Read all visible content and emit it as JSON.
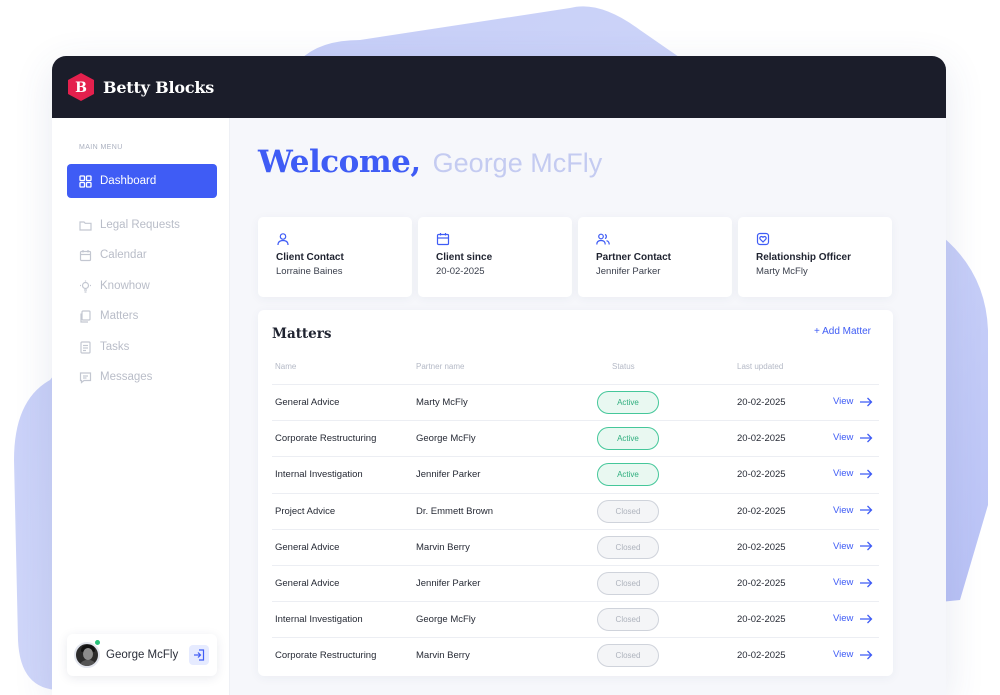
{
  "brand": {
    "name": "Betty Blocks",
    "logo_letter": "B",
    "accent": "#3f5cf5",
    "logo_color": "#e4204d"
  },
  "sidebar": {
    "caption": "MAIN MENU",
    "items": [
      {
        "label": "Dashboard",
        "icon": "grid-icon",
        "active": true
      },
      {
        "label": "Legal Requests",
        "icon": "folder-icon",
        "active": false
      },
      {
        "label": "Calendar",
        "icon": "calendar-icon",
        "active": false
      },
      {
        "label": "Knowhow",
        "icon": "lightbulb-icon",
        "active": false
      },
      {
        "label": "Matters",
        "icon": "files-icon",
        "active": false
      },
      {
        "label": "Tasks",
        "icon": "document-icon",
        "active": false
      },
      {
        "label": "Messages",
        "icon": "chat-icon",
        "active": false
      }
    ],
    "user": {
      "name": "George McFly",
      "status": "online"
    }
  },
  "main": {
    "welcome_word": "Welcome,",
    "welcome_name": "George McFly",
    "info_cards": [
      {
        "label": "Client Contact",
        "value": "Lorraine Baines",
        "icon": "user-icon"
      },
      {
        "label": "Client since",
        "value": "20-02-2025",
        "icon": "calendar-icon"
      },
      {
        "label": "Partner Contact",
        "value": "Jennifer Parker",
        "icon": "users-icon"
      },
      {
        "label": "Relationship Officer",
        "value": "Marty McFly",
        "icon": "heart-badge-icon"
      }
    ],
    "matters": {
      "title": "Matters",
      "add_label": "+ Add Matter",
      "columns": [
        "Name",
        "Partner name",
        "Status",
        "Last updated"
      ],
      "view_label": "View",
      "rows": [
        {
          "name": "General Advice",
          "partner": "Marty McFly",
          "status": "Active",
          "updated": "20-02-2025"
        },
        {
          "name": "Corporate Restructuring",
          "partner": "George McFly",
          "status": "Active",
          "updated": "20-02-2025"
        },
        {
          "name": "Internal Investigation",
          "partner": "Jennifer Parker",
          "status": "Active",
          "updated": "20-02-2025"
        },
        {
          "name": "Project Advice",
          "partner": "Dr. Emmett Brown",
          "status": "Closed",
          "updated": "20-02-2025"
        },
        {
          "name": "General Advice",
          "partner": "Marvin Berry",
          "status": "Closed",
          "updated": "20-02-2025"
        },
        {
          "name": "General Advice",
          "partner": "Jennifer Parker",
          "status": "Closed",
          "updated": "20-02-2025"
        },
        {
          "name": "Internal Investigation",
          "partner": "George McFly",
          "status": "Closed",
          "updated": "20-02-2025"
        },
        {
          "name": "Corporate Restructuring",
          "partner": "Marvin Berry",
          "status": "Closed",
          "updated": "20-02-2025"
        }
      ]
    }
  }
}
